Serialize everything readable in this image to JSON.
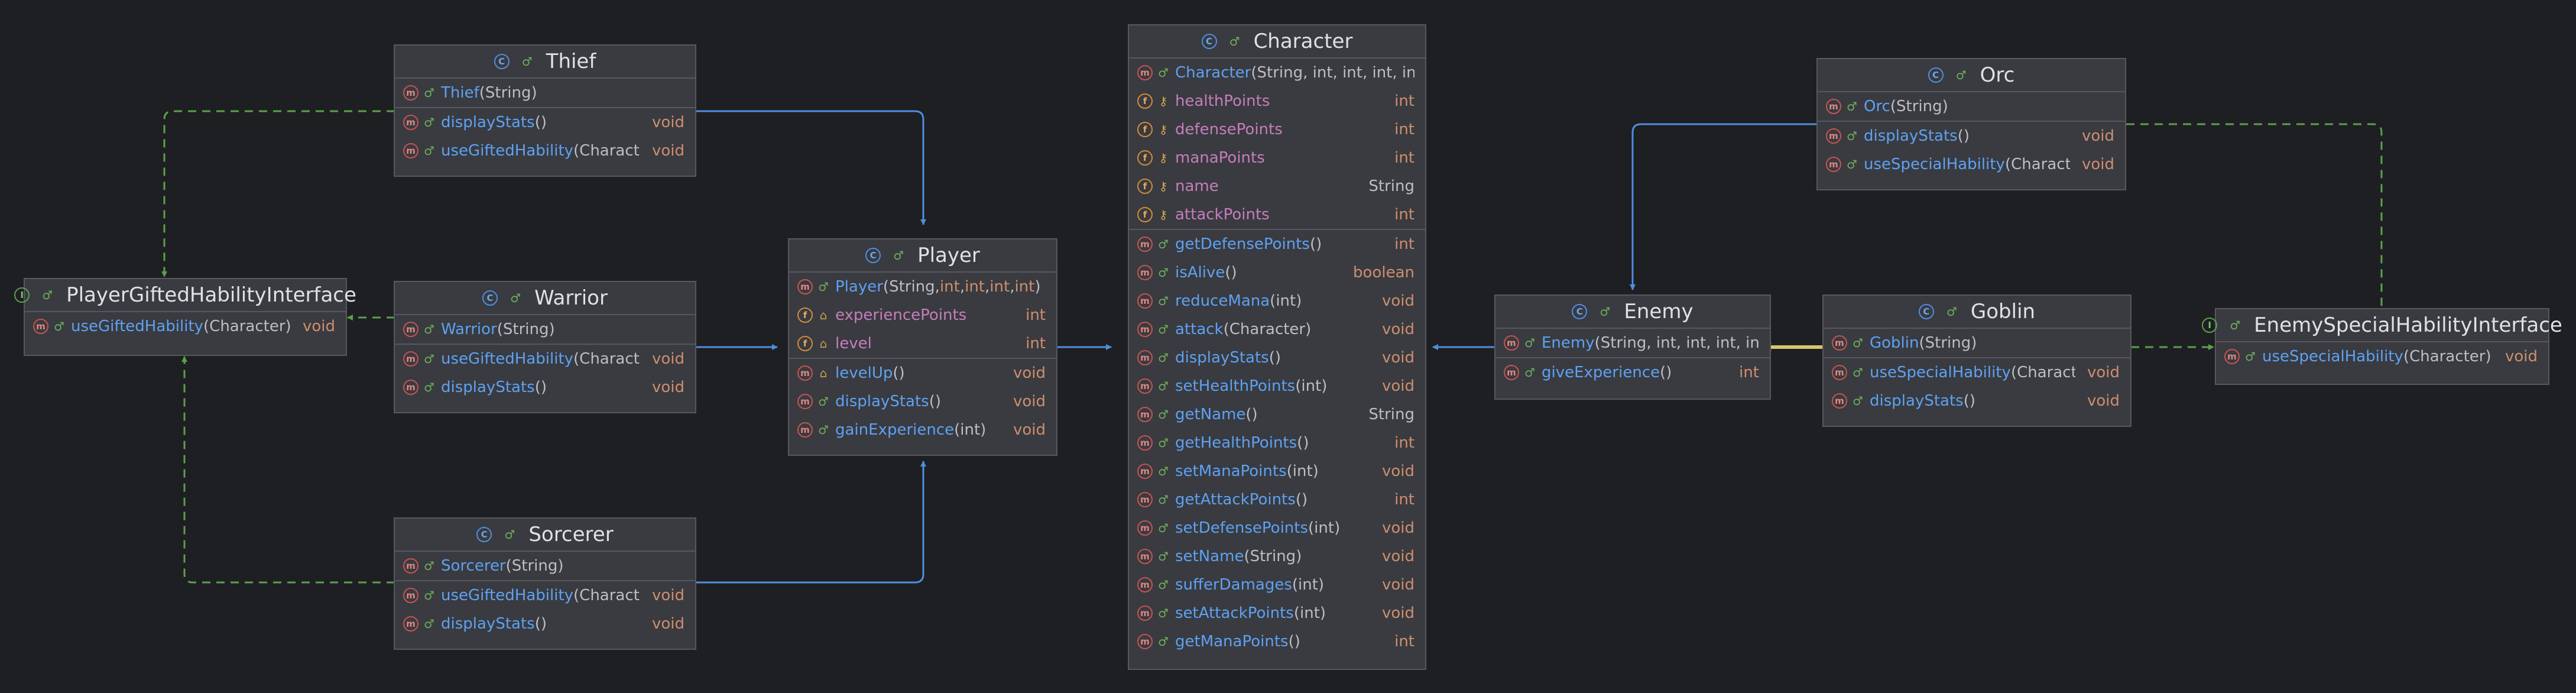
{
  "colors": {
    "background": "#1e1f22",
    "node_fill": "#393b40",
    "node_border": "#56585e",
    "extends_edge": "#4f8ee0",
    "implements_edge": "#5aa14c",
    "association_edge": "#d9c56d"
  },
  "icons": {
    "class": "class-icon",
    "interface": "interface-icon",
    "method": "method-icon",
    "field": "field-icon",
    "public": "public-visibility-icon",
    "private": "private-visibility-icon",
    "protected": "protected-visibility-icon"
  },
  "nodes": {
    "thief": {
      "title": "Thief",
      "members": [
        {
          "name": "Thief",
          "params": "(String)",
          "type": ""
        },
        {
          "name": "displayStats",
          "params": "()",
          "type": "void"
        },
        {
          "name": "useGiftedHability",
          "params": "(Character)",
          "type": "void"
        }
      ]
    },
    "warrior": {
      "title": "Warrior",
      "members": [
        {
          "name": "Warrior",
          "params": "(String)",
          "type": ""
        },
        {
          "name": "useGiftedHability",
          "params": "(Character)",
          "type": "void"
        },
        {
          "name": "displayStats",
          "params": "()",
          "type": "void"
        }
      ]
    },
    "sorcerer": {
      "title": "Sorcerer",
      "members": [
        {
          "name": "Sorcerer",
          "params": "(String)",
          "type": ""
        },
        {
          "name": "useGiftedHability",
          "params": "(Character)",
          "type": "void"
        },
        {
          "name": "displayStats",
          "params": "()",
          "type": "void"
        }
      ]
    },
    "player_iface": {
      "title": "PlayerGiftedHabilityInterface",
      "members": [
        {
          "name": "useGiftedHability",
          "params": "(Character)",
          "type": "void"
        }
      ]
    },
    "player": {
      "title": "Player",
      "ctor": {
        "name": "Player",
        "params": "(String, ",
        "p1": "int",
        ",": ", ",
        "p2": "int",
        "p3": "int",
        "p4": "int",
        "close": ")"
      },
      "fields": [
        {
          "name": "experiencePoints",
          "type": "int"
        },
        {
          "name": "level",
          "type": "int"
        }
      ],
      "methods": [
        {
          "name": "levelUp",
          "params": "()",
          "type": "void"
        },
        {
          "name": "displayStats",
          "params": "()",
          "type": "void"
        },
        {
          "name": "gainExperience",
          "params": "(int)",
          "type": "void"
        }
      ]
    },
    "character": {
      "title": "Character",
      "ctor": {
        "name": "Character",
        "params": "(String, int, int, int, int)"
      },
      "fields": [
        {
          "name": "healthPoints",
          "type": "int"
        },
        {
          "name": "defensePoints",
          "type": "int"
        },
        {
          "name": "manaPoints",
          "type": "int"
        },
        {
          "name": "name",
          "type": "String"
        },
        {
          "name": "attackPoints",
          "type": "int"
        }
      ],
      "methods": [
        {
          "name": "getDefensePoints",
          "params": "()",
          "type": "int"
        },
        {
          "name": "isAlive",
          "params": "()",
          "type": "boolean"
        },
        {
          "name": "reduceMana",
          "params": "(int)",
          "type": "void"
        },
        {
          "name": "attack",
          "params": "(Character)",
          "type": "void"
        },
        {
          "name": "displayStats",
          "params": "()",
          "type": "void"
        },
        {
          "name": "setHealthPoints",
          "params": "(int)",
          "type": "void"
        },
        {
          "name": "getName",
          "params": "()",
          "type": "String"
        },
        {
          "name": "getHealthPoints",
          "params": "()",
          "type": "int"
        },
        {
          "name": "setManaPoints",
          "params": "(int)",
          "type": "void"
        },
        {
          "name": "getAttackPoints",
          "params": "()",
          "type": "int"
        },
        {
          "name": "setDefensePoints",
          "params": "(int)",
          "type": "void"
        },
        {
          "name": "setName",
          "params": "(String)",
          "type": "void"
        },
        {
          "name": "sufferDamages",
          "params": "(int)",
          "type": "void"
        },
        {
          "name": "setAttackPoints",
          "params": "(int)",
          "type": "void"
        },
        {
          "name": "getManaPoints",
          "params": "()",
          "type": "int"
        }
      ]
    },
    "orc": {
      "title": "Orc",
      "members": [
        {
          "name": "Orc",
          "params": "(String)",
          "type": ""
        },
        {
          "name": "displayStats",
          "params": "()",
          "type": "void"
        },
        {
          "name": "useSpecialHability",
          "params": "(Character)",
          "type": "void"
        }
      ]
    },
    "enemy": {
      "title": "Enemy",
      "members": [
        {
          "name": "Enemy",
          "params": "(String, int, int, int, int)",
          "type": ""
        },
        {
          "name": "giveExperience",
          "params": "()",
          "type": "int"
        }
      ]
    },
    "goblin": {
      "title": "Goblin",
      "members": [
        {
          "name": "Goblin",
          "params": "(String)",
          "type": ""
        },
        {
          "name": "useSpecialHability",
          "params": "(Character)",
          "type": "void"
        },
        {
          "name": "displayStats",
          "params": "()",
          "type": "void"
        }
      ]
    },
    "enemy_iface": {
      "title": "EnemySpecialHabilityInterface",
      "members": [
        {
          "name": "useSpecialHability",
          "params": "(Character)",
          "type": "void"
        }
      ]
    }
  }
}
